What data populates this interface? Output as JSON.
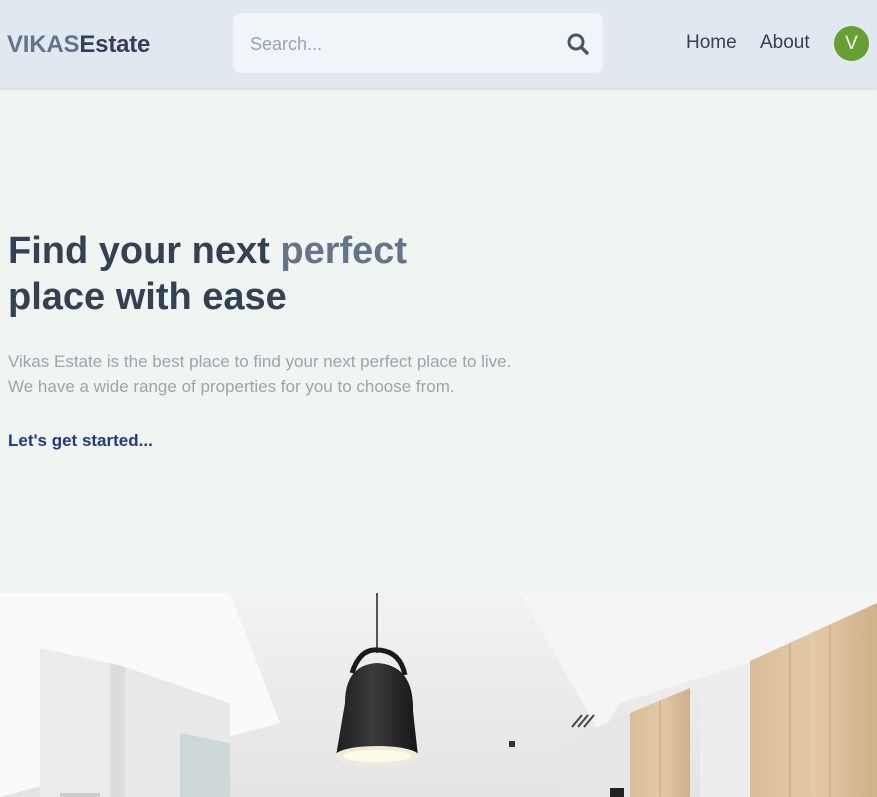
{
  "header": {
    "logo_part1": "VIKAS",
    "logo_part2": "Estate",
    "search_placeholder": "Search...",
    "nav": {
      "home": "Home",
      "about": "About"
    },
    "avatar_initial": "V",
    "avatar_color": "#65a030"
  },
  "hero": {
    "title_part1": "Find your next ",
    "title_accent": "perfect",
    "title_part2": "place with ease",
    "description_line1": "Vikas Estate is the best place to find your next perfect place to live.",
    "description_line2": "We have a wide range of properties for you to choose from.",
    "cta": "Let's get started..."
  },
  "icons": {
    "search": "search-icon"
  },
  "colors": {
    "header_bg": "#e2e8f0",
    "page_bg": "#f1f5f1",
    "heading": "#334155",
    "accent": "#64748b",
    "link": "#1e3a8a"
  }
}
